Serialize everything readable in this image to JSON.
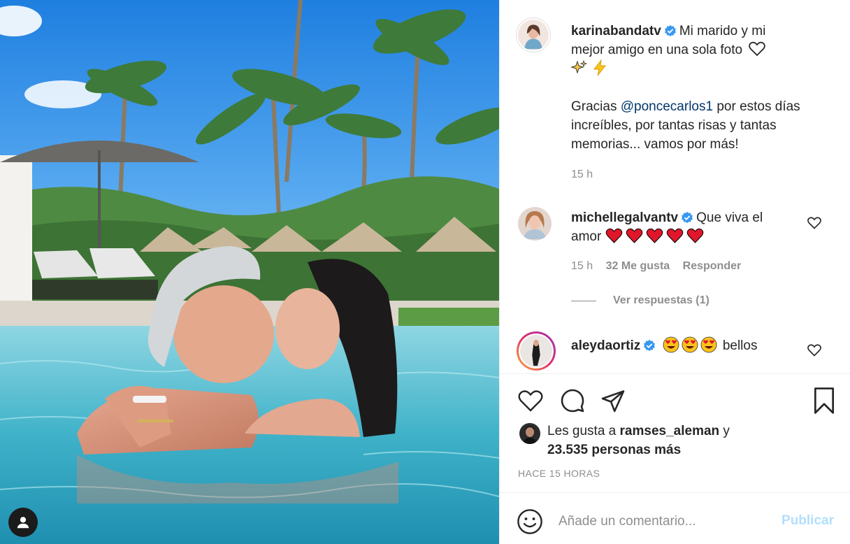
{
  "post": {
    "photo_alt": "",
    "caption": {
      "username": "karinabandatv",
      "line1": "Mi marido y mi",
      "line2": "mejor amigo en una sola foto",
      "para2_pre": "Gracias ",
      "mention": "@poncecarlos1",
      "para2_post": " por estos días",
      "para2_line2": "increíbles, por tantas risas y tantas",
      "para2_line3": "memorias... vamos por más!",
      "time": "15 h"
    },
    "comments": [
      {
        "username": "michellegalvantv",
        "text_pre": "Que viva el",
        "text_line2": "amor",
        "emoji": "red-heart-icon x5",
        "time": "15 h",
        "likes": "32 Me gusta",
        "reply": "Responder"
      },
      {
        "username": "aleydaortiz",
        "emoji": "heart-eyes-face-icon x3",
        "text": "bellos"
      }
    ],
    "view_replies": "Ver respuestas (1)",
    "likes": {
      "prefix": "Les gusta a ",
      "user": "ramses_aleman",
      "mid": " y",
      "count": "23.535 personas más"
    },
    "timestamp": "HACE 15 HORAS",
    "add_comment": {
      "placeholder": "Añade un comentario...",
      "publish": "Publicar"
    }
  },
  "colors": {
    "text": "#262626",
    "muted": "#8e8e8e",
    "mention": "#00376b",
    "verified": "#3897f0",
    "publish_disabled": "#b2dffc"
  }
}
